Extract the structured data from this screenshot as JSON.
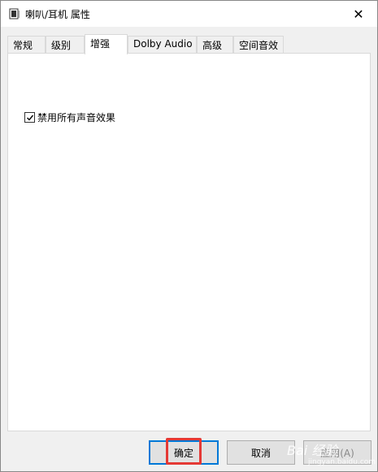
{
  "window": {
    "title": "喇叭/耳机 属性",
    "close_glyph": "✕"
  },
  "tabs": [
    {
      "label": "常规"
    },
    {
      "label": "级别"
    },
    {
      "label": "增强"
    },
    {
      "label": "Dolby Audio"
    },
    {
      "label": "高级"
    },
    {
      "label": "空间音效"
    }
  ],
  "active_tab": "增强",
  "enhancement": {
    "disable_all_label": "禁用所有声音效果",
    "disable_all_checked": true
  },
  "buttons": {
    "ok": "确定",
    "cancel": "取消",
    "apply": "应用(A)"
  },
  "watermark": {
    "text": "Bai 经验",
    "sub": "jingyan.baidu.com"
  },
  "colors": {
    "focus_border": "#0078d7",
    "highlight": "#e53935"
  }
}
